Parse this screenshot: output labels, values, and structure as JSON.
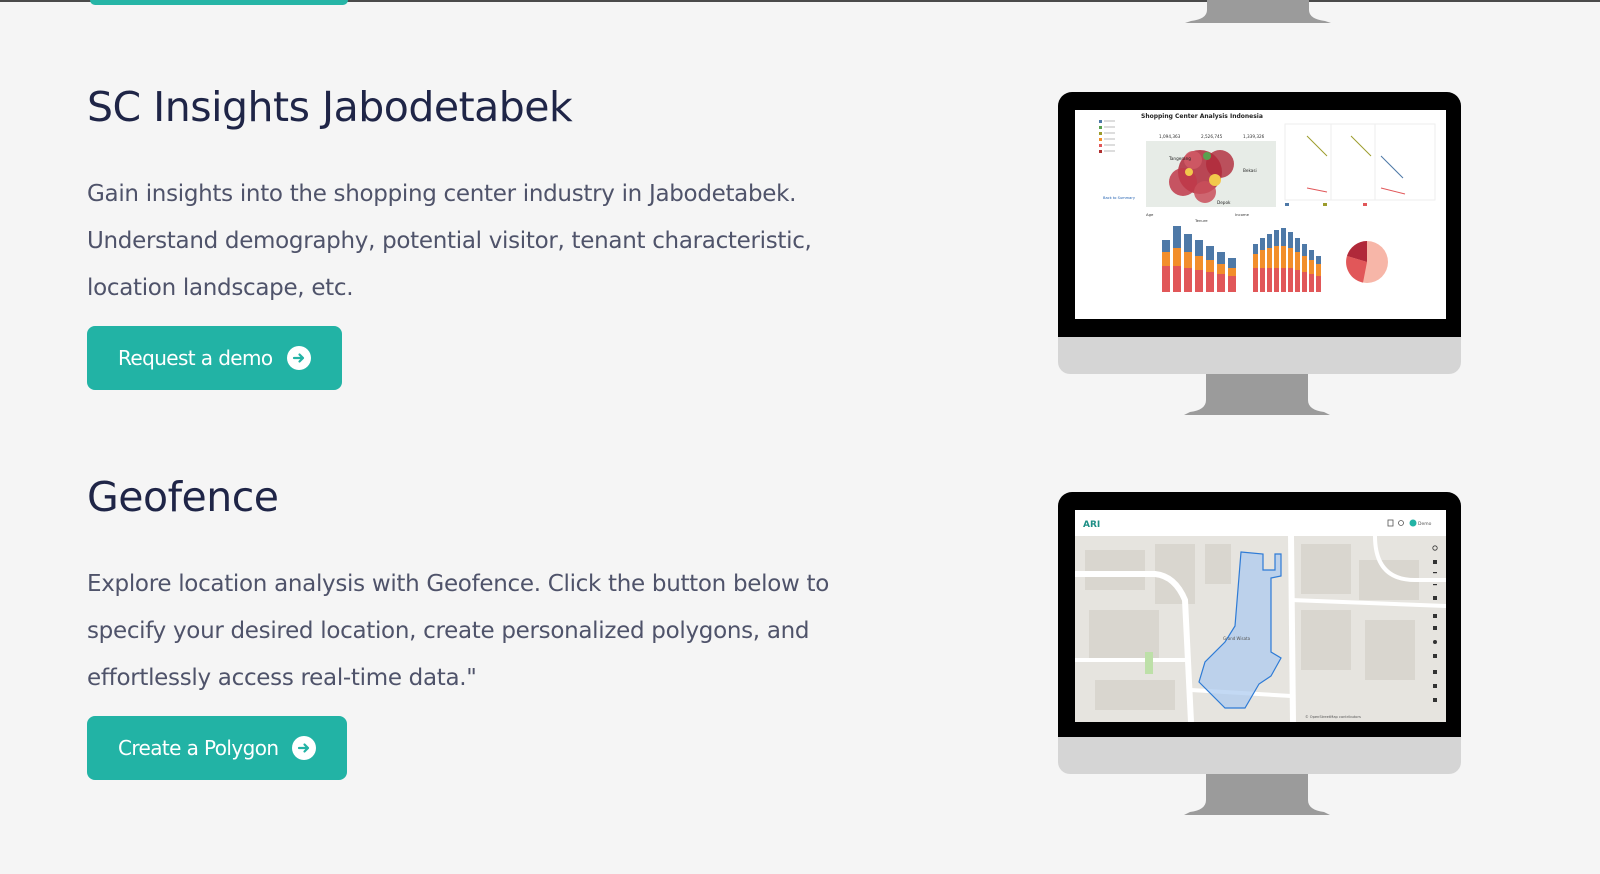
{
  "features": [
    {
      "title": "SC Insights Jabodetabek",
      "description": "Gain insights into the shopping center industry in Jabodetabek. Understand demography, potential visitor, tenant characteristic, location landscape, etc.",
      "cta_label": "Request a demo",
      "screen": {
        "dashboard_title": "Shopping Center Analysis Indonesia",
        "kpis": [
          "1,094,363",
          "2,526,745",
          "1,339,326"
        ],
        "map_labels": [
          "Tangerang",
          "Bekasi",
          "Depok"
        ],
        "chart_titles": [
          "Age",
          "Tenure",
          "Income"
        ],
        "link_text": "Back to Summary"
      }
    },
    {
      "title": "Geofence",
      "description": "Explore location analysis with Geofence. Click the button below to specify your desired location, create personalized polygons, and effortlessly access real-time data.\"",
      "cta_label": "Create a Polygon",
      "screen": {
        "app_logo": "ARI",
        "user_label": "Demo",
        "map_label": "Grand Wisata",
        "map_credit": "© OpenStreetMap contributors"
      }
    }
  ],
  "icons": {
    "cta": "arrow-right-circle-icon"
  },
  "colors": {
    "background": "#f5f5f5",
    "accent": "#22b3a5",
    "heading": "#1f2547",
    "body_text": "#4f536a"
  }
}
